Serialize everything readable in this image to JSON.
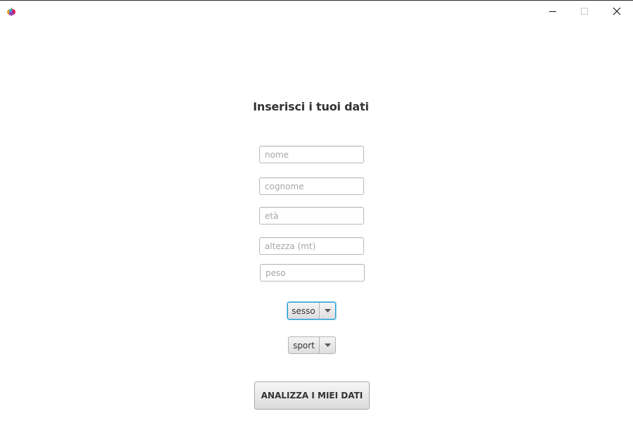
{
  "window": {
    "icon": "app-fruit-icon",
    "controls": {
      "minimize_icon": "minimize-icon",
      "maximize_icon": "maximize-icon",
      "close_icon": "close-icon"
    }
  },
  "form": {
    "title": "Inserisci i tuoi dati",
    "fields": {
      "nome": {
        "placeholder": "nome",
        "value": ""
      },
      "cognome": {
        "placeholder": "cognome",
        "value": ""
      },
      "eta": {
        "placeholder": "età",
        "value": ""
      },
      "altezza": {
        "placeholder": "altezza (mt)",
        "value": ""
      },
      "peso": {
        "placeholder": "peso",
        "value": ""
      }
    },
    "sesso_combo": {
      "label": "sesso"
    },
    "sport_combo": {
      "label": "sport"
    },
    "submit_label": "ANALIZZA I MIEI DATI"
  },
  "colors": {
    "focus_accent": "#1e9ad6",
    "title_text": "#333333"
  }
}
